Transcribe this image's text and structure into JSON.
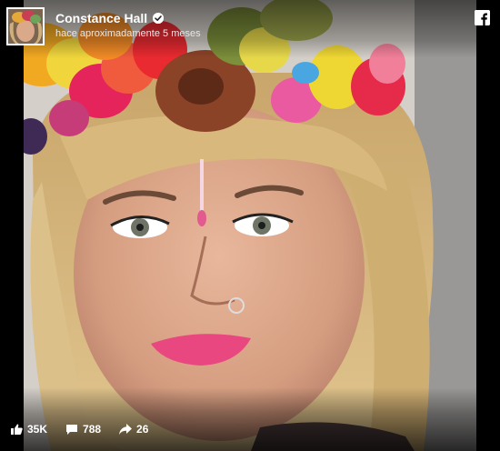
{
  "post": {
    "author_name": "Constance Hall",
    "timestamp": "hace aproximadamente 5 meses",
    "verified_icon": "verified-badge-icon",
    "platform_icon": "facebook-icon"
  },
  "stats": {
    "likes": "35K",
    "comments": "788",
    "shares": "26"
  },
  "colors": {
    "background": "#000000",
    "text": "#ffffff",
    "lips": "#e8477f"
  }
}
